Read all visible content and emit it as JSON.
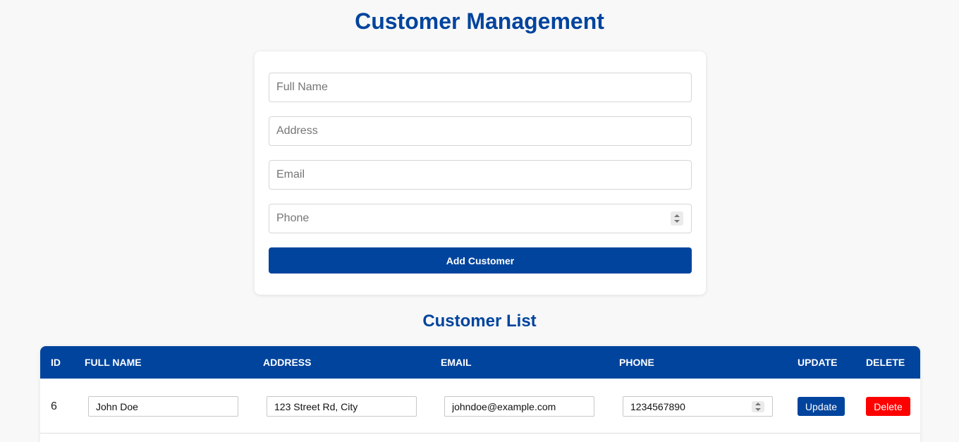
{
  "header": {
    "title": "Customer Management"
  },
  "form": {
    "full_name_placeholder": "Full Name",
    "address_placeholder": "Address",
    "email_placeholder": "Email",
    "phone_placeholder": "Phone",
    "submit_label": "Add Customer"
  },
  "list": {
    "title": "Customer List",
    "columns": [
      "ID",
      "Full Name",
      "Address",
      "Email",
      "Phone",
      "Update",
      "Delete"
    ],
    "rows": [
      {
        "id": "6",
        "full_name": "John Doe",
        "address": "123 Street Rd, City",
        "email": "johndoe@example.com",
        "phone": "1234567890",
        "update_label": "Update",
        "delete_label": "Delete"
      }
    ]
  },
  "colors": {
    "primary": "#00449d",
    "danger": "#ff0000",
    "background": "#f8f8f8"
  }
}
